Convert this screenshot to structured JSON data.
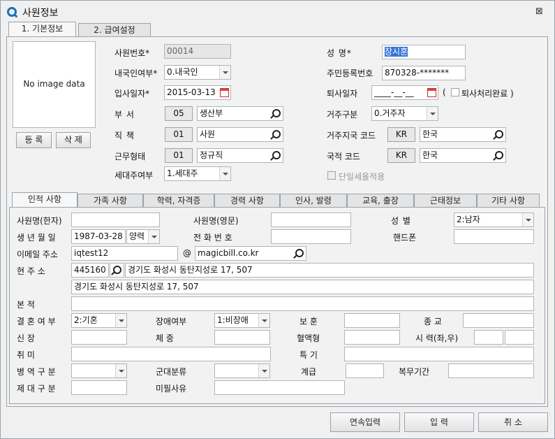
{
  "window": {
    "title": "사원정보",
    "close": "⊠"
  },
  "main_tabs": [
    "1. 기본정보",
    "2. 급여설정"
  ],
  "photo": {
    "placeholder": "No image data",
    "register": "등 록",
    "delete": "삭 제"
  },
  "basic": {
    "emp_no_label": "사원번호*",
    "emp_no": "00014",
    "nationality_label": "내국인여부*",
    "nationality": "0.내국인",
    "join_date_label": "입사일자*",
    "join_date": "2015-03-13",
    "dept_label": "부    서",
    "dept_code": "05",
    "dept_name": "생산부",
    "position_label": "직    책",
    "position_code": "01",
    "position_name": "사원",
    "work_type_label": "근무형태",
    "work_type_code": "01",
    "work_type_name": "정규직",
    "householder_label": "세대주여부",
    "householder": "1.세대주",
    "name_label": "성    명*",
    "name": "장시훈",
    "rrn_label": "주민등록번호",
    "rrn": "870328-*******",
    "resign_label": "퇴사일자",
    "resign_date": "____-__-__",
    "resign_done_label": "퇴사처리완료 )",
    "resign_paren": "(",
    "residence_label": "거주구분",
    "residence": "0.거주자",
    "res_country_label": "거주지국 코드",
    "res_country_code": "KR",
    "res_country_name": "한국",
    "nat_code_label": "국적 코드",
    "nat_code": "KR",
    "nat_name": "한국",
    "single_tax_label": "단일세율적용"
  },
  "sub_tabs": [
    "인적 사항",
    "가족 사항",
    "학력, 자격증",
    "경력 사항",
    "인사, 발령",
    "교육, 출장",
    "근태정보",
    "기타 사항"
  ],
  "personal": {
    "name_hanja_label": "사원명(한자)",
    "name_hanja": "",
    "name_en_label": "사원명(영문)",
    "name_en": "",
    "gender_label": "성    별",
    "gender": "2:남자",
    "birth_label": "생 년 월 일",
    "birth": "1987-03-28",
    "calendar_type": "양력",
    "phone_label": "전 화 번 호",
    "phone": "",
    "mobile_label": "핸드폰",
    "mobile": "",
    "email_label": "이메일 주소",
    "email_id": "iqtest12",
    "at": "@",
    "email_domain": "magicbill.co.kr",
    "address_label": "현    주    소",
    "zip": "445160",
    "address1": "경기도 화성시 동탄지성로 17, 507",
    "address2": "경기도 화성시 동탄지성로 17, 507",
    "origin_label": "본          적",
    "origin": "",
    "marriage_label": "결 혼 여 부",
    "marriage": "2:기혼",
    "disability_label": "장애여부",
    "disability": "1:비장애",
    "veteran_label": "보 훈",
    "veteran": "",
    "religion_label": "종 교",
    "religion": "",
    "height_label": "신          장",
    "height": "",
    "weight_label": "체    중",
    "weight": "",
    "blood_label": "혈액형",
    "blood": "",
    "vision_label": "시 력(좌,우)",
    "vision_left": "",
    "vision_right": "",
    "hobby_label": "취          미",
    "hobby": "",
    "special_label": "특 기",
    "special": "",
    "military_label": "병 역 구 분",
    "military": "",
    "army_type_label": "군대분류",
    "army_type": "",
    "rank_label": "계급",
    "rank": "",
    "service_period_label": "복무기간",
    "service_period": "",
    "discharge_label": "제 대 구 분",
    "discharge": "",
    "exempt_label": "미필사유",
    "exempt": ""
  },
  "footer": {
    "continuous": "연속입력",
    "input": "입    력",
    "cancel": "취    소"
  }
}
